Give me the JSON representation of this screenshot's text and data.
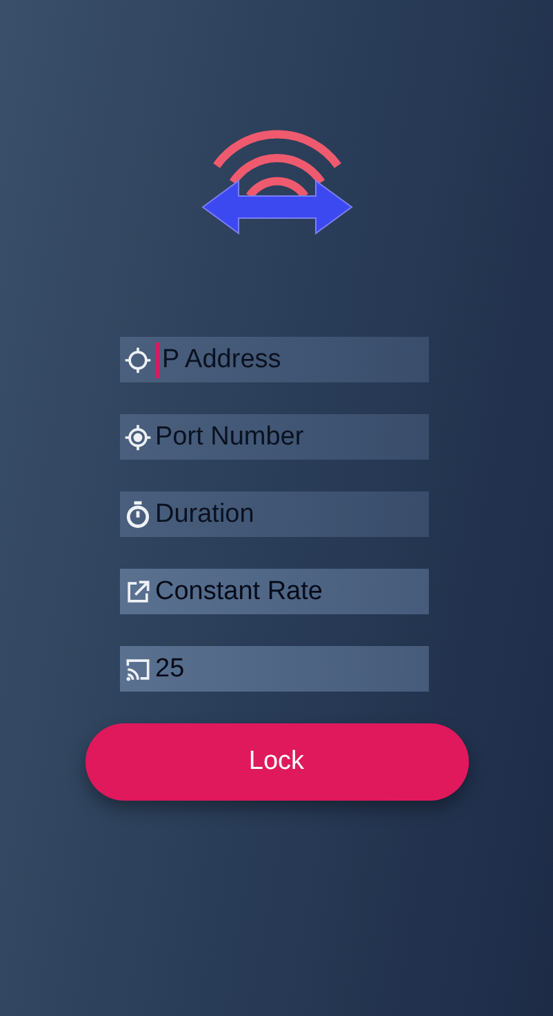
{
  "fields": [
    {
      "kind": "crosshair",
      "placeholder": "P Address",
      "focused": true
    },
    {
      "kind": "target",
      "placeholder": "Port Number",
      "focused": false
    },
    {
      "kind": "timer",
      "placeholder": "Duration",
      "focused": false
    },
    {
      "kind": "launch",
      "value": "Constant Rate",
      "focused": false
    },
    {
      "kind": "cast",
      "value": "25",
      "focused": false
    }
  ],
  "button": {
    "label": "Lock"
  }
}
